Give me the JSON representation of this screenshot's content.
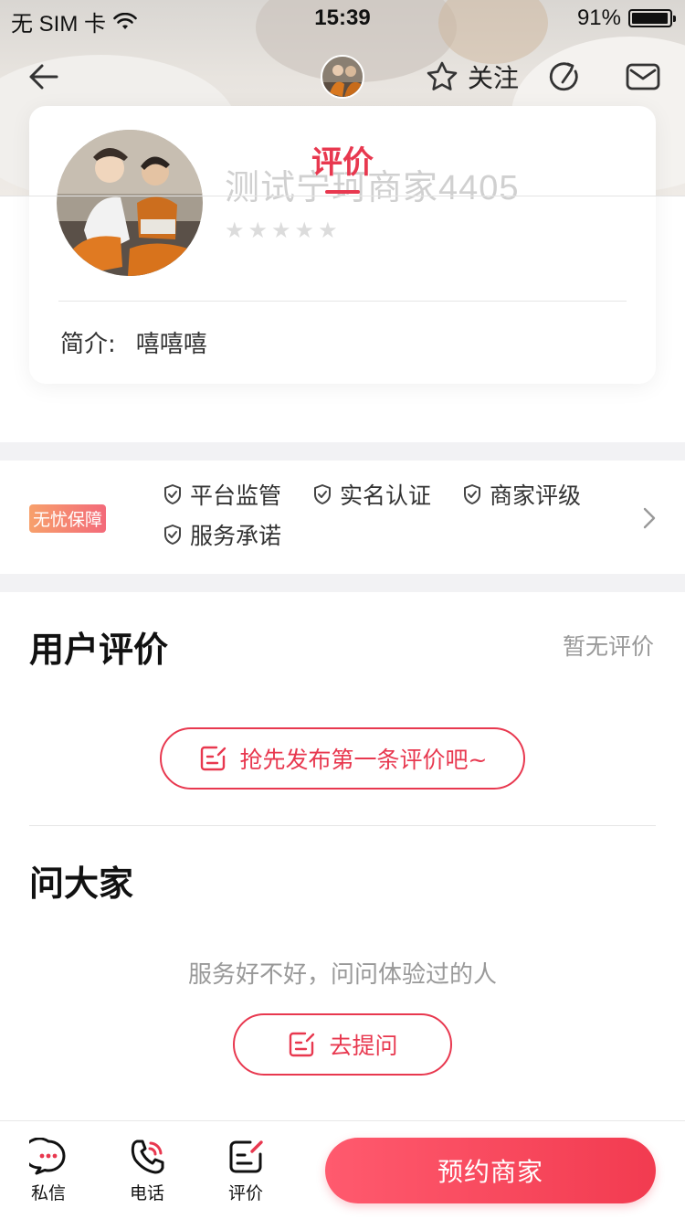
{
  "status_bar": {
    "carrier": "无 SIM 卡",
    "time": "15:39",
    "battery": "91%"
  },
  "nav": {
    "follow_label": "关注"
  },
  "header": {
    "tab_label": "评价"
  },
  "merchant": {
    "name": "测试宁珂商家4405",
    "rating_stars": 0,
    "intro_label": "简介:",
    "intro_text": "嘻嘻嘻"
  },
  "guarantee": {
    "badge": "无忧保障",
    "items": [
      "平台监管",
      "实名认证",
      "商家评级",
      "服务承诺"
    ]
  },
  "reviews": {
    "title": "用户评价",
    "status": "暂无评价",
    "cta": "抢先发布第一条评价吧~"
  },
  "ask": {
    "title": "问大家",
    "subtitle": "服务好不好，问问体验过的人",
    "cta": "去提问"
  },
  "bottom_bar": {
    "message_label": "私信",
    "phone_label": "电话",
    "review_label": "评价",
    "book_label": "预约商家"
  },
  "colors": {
    "accent": "#e8384f",
    "button_gradient_start": "#ff5a6e",
    "button_gradient_end": "#f23b50"
  }
}
